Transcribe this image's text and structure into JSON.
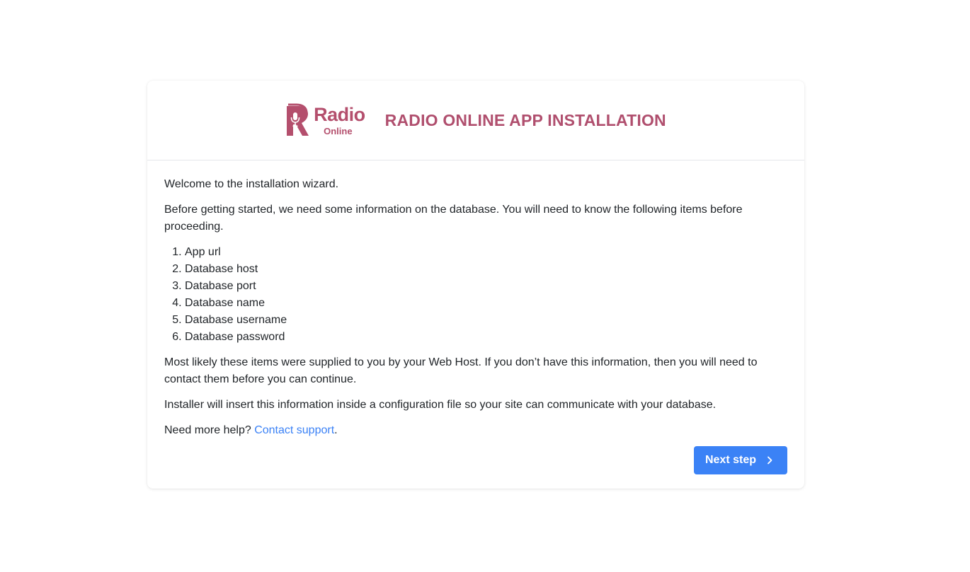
{
  "header": {
    "logo": {
      "word": "Radio",
      "subword": "Online",
      "icon": "radio-microphone-icon"
    },
    "title": "RADIO ONLINE APP INSTALLATION"
  },
  "body": {
    "welcome": "Welcome to the installation wizard.",
    "intro": "Before getting started, we need some information on the database. You will need to know the following items before proceeding.",
    "items": [
      "App url",
      "Database host",
      "Database port",
      "Database name",
      "Database username",
      "Database password"
    ],
    "webhost_note": "Most likely these items were supplied to you by your Web Host. If you don’t have this information, then you will need to contact them before you can continue.",
    "installer_note": "Installer will insert this information inside a configuration file so your site can communicate with your database.",
    "help_prefix": "Need more help? ",
    "help_link": "Contact support",
    "help_suffix": "."
  },
  "actions": {
    "next_label": "Next step",
    "next_icon": "chevron-right-icon"
  },
  "colors": {
    "brand": "#b04f6e",
    "primary": "#3b82f6",
    "text": "#212529"
  }
}
